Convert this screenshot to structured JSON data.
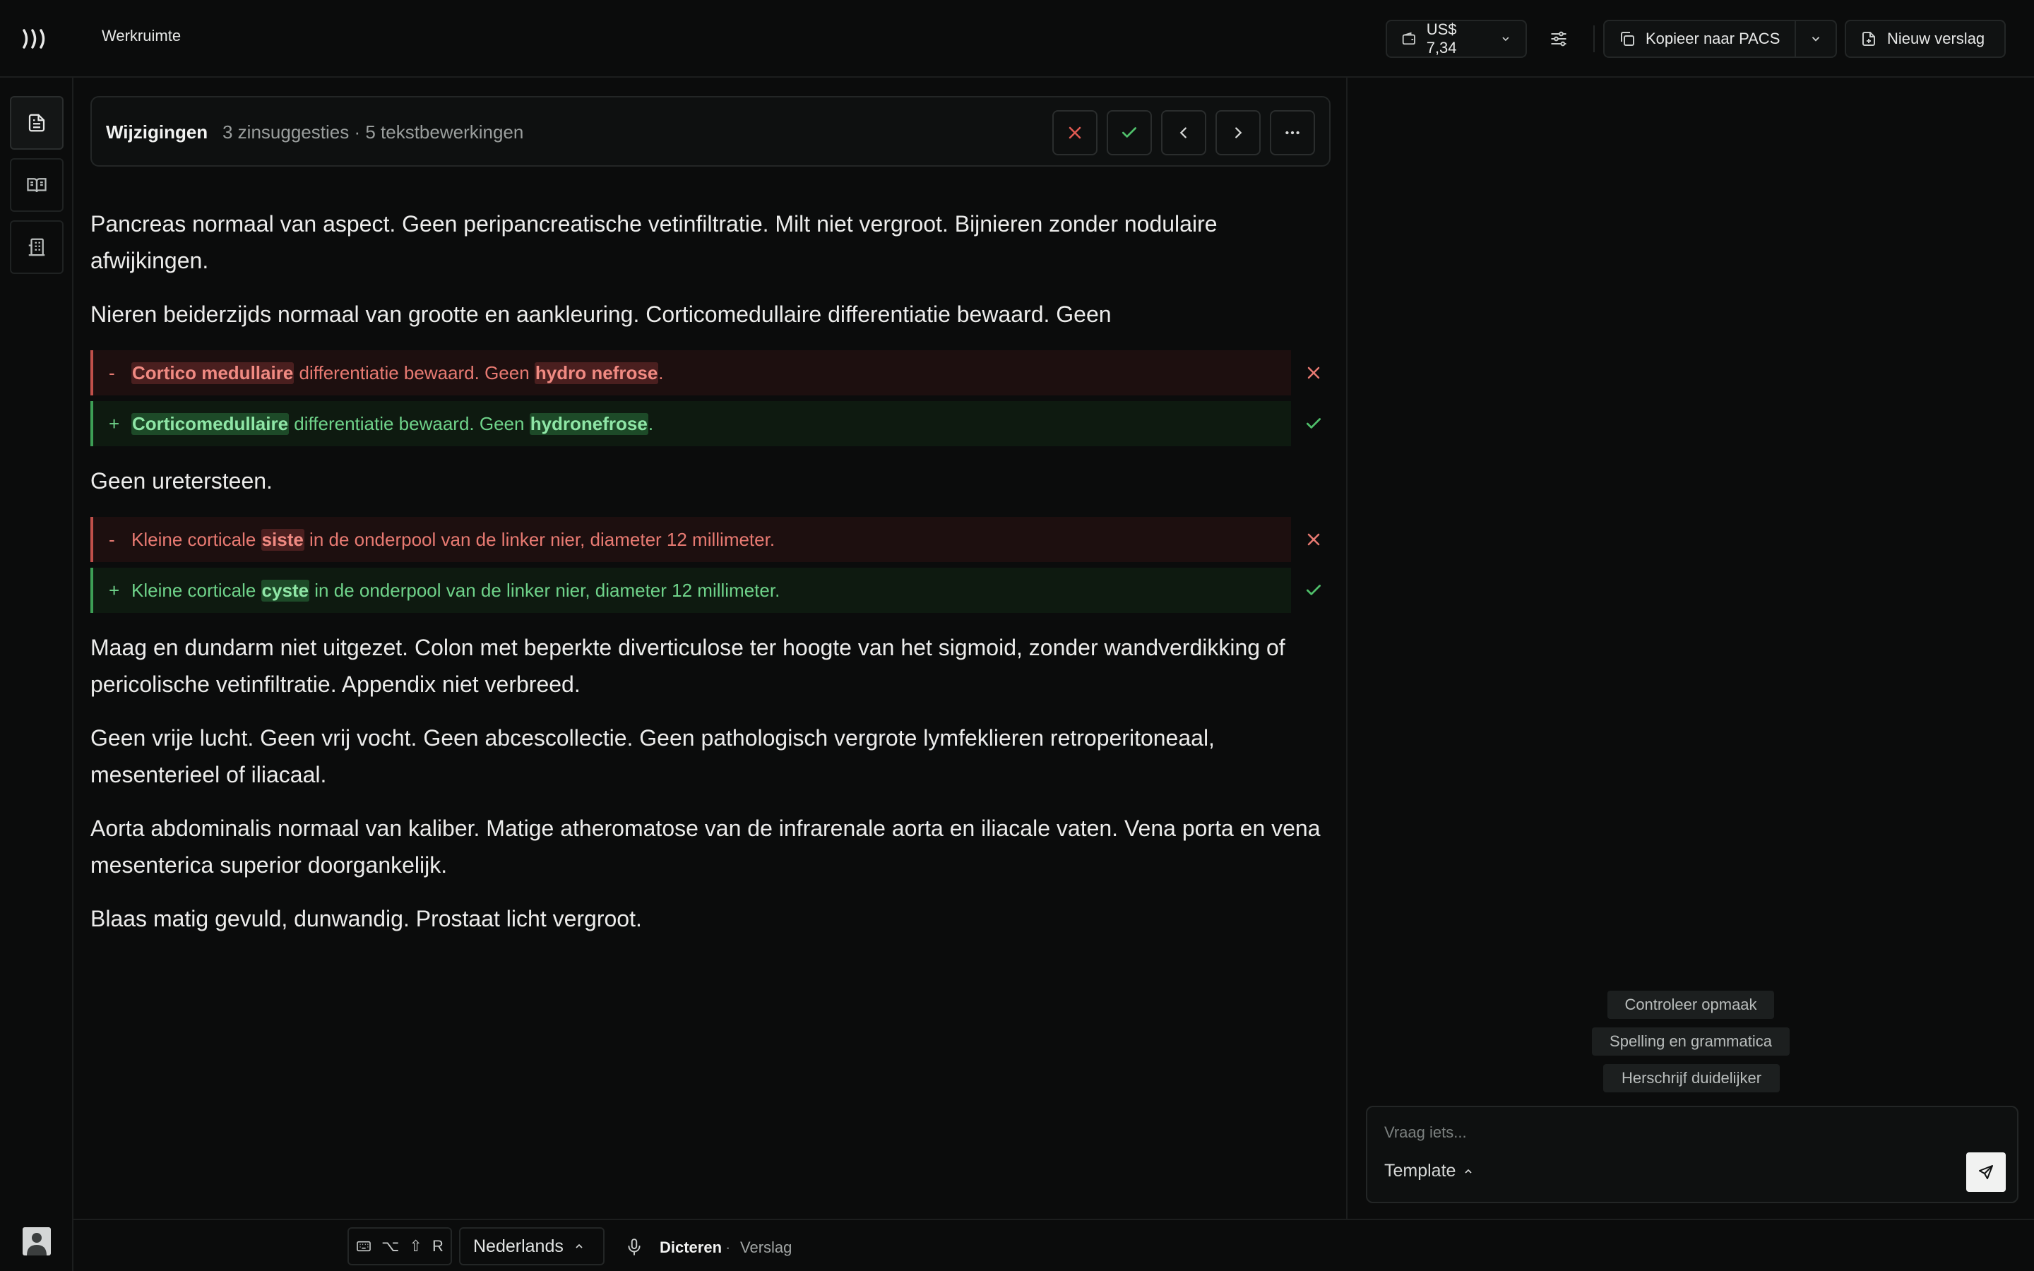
{
  "header": {
    "workspace_title": "Werkruimte",
    "cost": "US$ 7,34",
    "copy_pacs_label": "Kopieer naar PACS",
    "new_report_label": "Nieuw verslag"
  },
  "changes": {
    "title": "Wijzigingen",
    "summary": "3 zinsuggesties · 5 tekstbewerkingen"
  },
  "report": {
    "p1": "Pancreas normaal van aspect. Geen peripancreatische vetinfiltratie. Milt niet vergroot. Bijnieren zonder nodulaire afwijkingen.",
    "p2": "Nieren beiderzijds normaal van grootte en aankleuring. Corticomedullaire differentiatie bewaard. Geen",
    "p3": "Geen uretersteen.",
    "p4": "Maag en dundarm niet uitgezet. Colon met beperkte diverticulose ter hoogte van het sigmoid, zonder wandverdikking of pericolische vetinfiltratie. Appendix niet verbreed.",
    "p5": "Geen vrije lucht. Geen vrij vocht. Geen abcescollectie. Geen pathologisch vergrote lymfeklieren retroperitoneaal, mesenterieel of iliacaal.",
    "p6": "Aorta abdominalis normaal van kaliber. Matige atheromatose van de infrarenale aorta en iliacale vaten. Vena porta en vena mesenterica superior doorgankelijk.",
    "p7": "Blaas matig gevuld, dunwandig. Prostaat licht vergroot."
  },
  "diffs": {
    "d1_del": {
      "sign": "-",
      "hl1": "Cortico medullaire",
      "mid": " differentiatie bewaard. Geen ",
      "hl2": "hydro nefrose",
      "end": "."
    },
    "d1_add": {
      "sign": "+",
      "hl1": "Corticomedullaire",
      "mid": " differentiatie bewaard. Geen ",
      "hl2": "hydronefrose",
      "end": "."
    },
    "d2_del": {
      "sign": "-",
      "pre": "Kleine corticale ",
      "hl": "siste",
      "post": " in de onderpool van de linker nier, diameter 12 millimeter."
    },
    "d2_add": {
      "sign": "+",
      "pre": "Kleine corticale ",
      "hl": "cyste",
      "post": " in de onderpool van de linker nier, diameter 12 millimeter."
    }
  },
  "assistant": {
    "chips": [
      "Controleer opmaak",
      "Spelling en grammatica",
      "Herschrijf duidelijker"
    ],
    "input_placeholder": "Vraag iets...",
    "template_label": "Template"
  },
  "footer": {
    "shortcut_keys": [
      "⌥",
      "⇧",
      "R"
    ],
    "language": "Nederlands",
    "dictate_label": "Dicteren",
    "separator": "·",
    "mode_label": "Verslag"
  },
  "colors": {
    "background": "#0b0c0c",
    "deletion": "#e87a72",
    "addition": "#6fd38a"
  }
}
